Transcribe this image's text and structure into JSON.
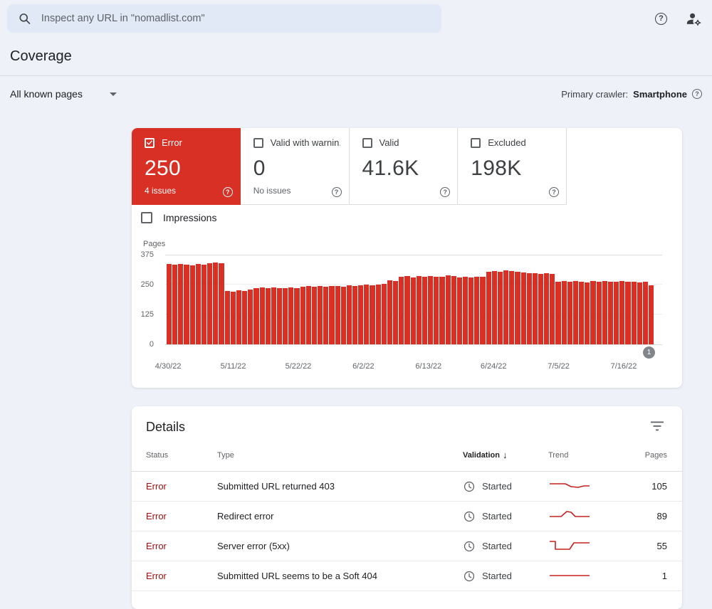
{
  "topbar": {
    "search_placeholder": "Inspect any URL in \"nomadlist.com\""
  },
  "page": {
    "title": "Coverage",
    "scope_dropdown": "All known pages",
    "crawler_label": "Primary crawler:",
    "crawler_value": "Smartphone"
  },
  "status_cards": [
    {
      "label": "Error",
      "value": "250",
      "sub": "4 issues",
      "checked": true,
      "selected": true
    },
    {
      "label": "Valid with warnin...",
      "value": "0",
      "sub": "No issues",
      "checked": false,
      "selected": false
    },
    {
      "label": "Valid",
      "value": "41.6K",
      "sub": "",
      "checked": false,
      "selected": false
    },
    {
      "label": "Excluded",
      "value": "198K",
      "sub": "",
      "checked": false,
      "selected": false
    }
  ],
  "impressions_label": "Impressions",
  "chart_data": {
    "type": "bar",
    "title": "",
    "ylabel": "Pages",
    "ylim": [
      0,
      375
    ],
    "yticks": [
      375,
      250,
      125,
      0
    ],
    "x_tick_labels": [
      "4/30/22",
      "5/11/22",
      "5/22/22",
      "6/2/22",
      "6/13/22",
      "6/24/22",
      "7/5/22",
      "7/16/22"
    ],
    "x_tick_interval_bars": 11,
    "bar_color": "#d93025",
    "grid": true,
    "scroll_badge": "1",
    "values": [
      336,
      333,
      337,
      334,
      331,
      335,
      332,
      338,
      342,
      339,
      224,
      219,
      227,
      222,
      229,
      236,
      239,
      235,
      238,
      236,
      234,
      237,
      235,
      241,
      243,
      240,
      244,
      242,
      245,
      243,
      241,
      246,
      244,
      248,
      251,
      247,
      250,
      252,
      268,
      264,
      282,
      285,
      281,
      286,
      283,
      287,
      284,
      282,
      288,
      285,
      280,
      283,
      281,
      284,
      282,
      305,
      308,
      304,
      309,
      306,
      303,
      300,
      297,
      299,
      295,
      298,
      296,
      262,
      265,
      261,
      266,
      263,
      260,
      264,
      262,
      266,
      263,
      261,
      264,
      261,
      263,
      259,
      262,
      247
    ]
  },
  "details": {
    "title": "Details",
    "columns": {
      "status": "Status",
      "type": "Type",
      "validation": "Validation",
      "trend": "Trend",
      "pages": "Pages"
    },
    "sorted_column": "Validation",
    "sort_direction": "desc",
    "rows": [
      {
        "status": "Error",
        "type": "Submitted URL returned 403",
        "validation": "Started",
        "pages": "105",
        "trend": [
          [
            2,
            9
          ],
          [
            24,
            9
          ],
          [
            32,
            13
          ],
          [
            42,
            14
          ],
          [
            50,
            12
          ],
          [
            58,
            12
          ]
        ]
      },
      {
        "status": "Error",
        "type": "Redirect error",
        "validation": "Started",
        "pages": "89",
        "trend": [
          [
            2,
            13
          ],
          [
            18,
            13
          ],
          [
            26,
            6
          ],
          [
            32,
            7
          ],
          [
            38,
            13
          ],
          [
            58,
            13
          ]
        ]
      },
      {
        "status": "Error",
        "type": "Server error (5xx)",
        "validation": "Started",
        "pages": "55",
        "trend": [
          [
            2,
            6
          ],
          [
            10,
            6
          ],
          [
            10,
            17
          ],
          [
            30,
            17
          ],
          [
            36,
            8
          ],
          [
            58,
            8
          ]
        ]
      },
      {
        "status": "Error",
        "type": "Submitted URL seems to be a Soft 404",
        "validation": "Started",
        "pages": "1",
        "trend": [
          [
            2,
            12
          ],
          [
            58,
            12
          ]
        ]
      }
    ]
  },
  "colors": {
    "error_red": "#d93025",
    "error_text_red": "#a50e0e",
    "trend_red": "#c5221f",
    "background": "#eef1f8",
    "search_pill": "#e1e9f6"
  },
  "icons": {
    "search": "magnifier",
    "help": "circled-question-mark",
    "account": "person-with-gear",
    "caret": "triangle-down",
    "check": "checkmark",
    "clock": "clock-face",
    "filter": "filter-lines",
    "sort": "arrow-down"
  }
}
